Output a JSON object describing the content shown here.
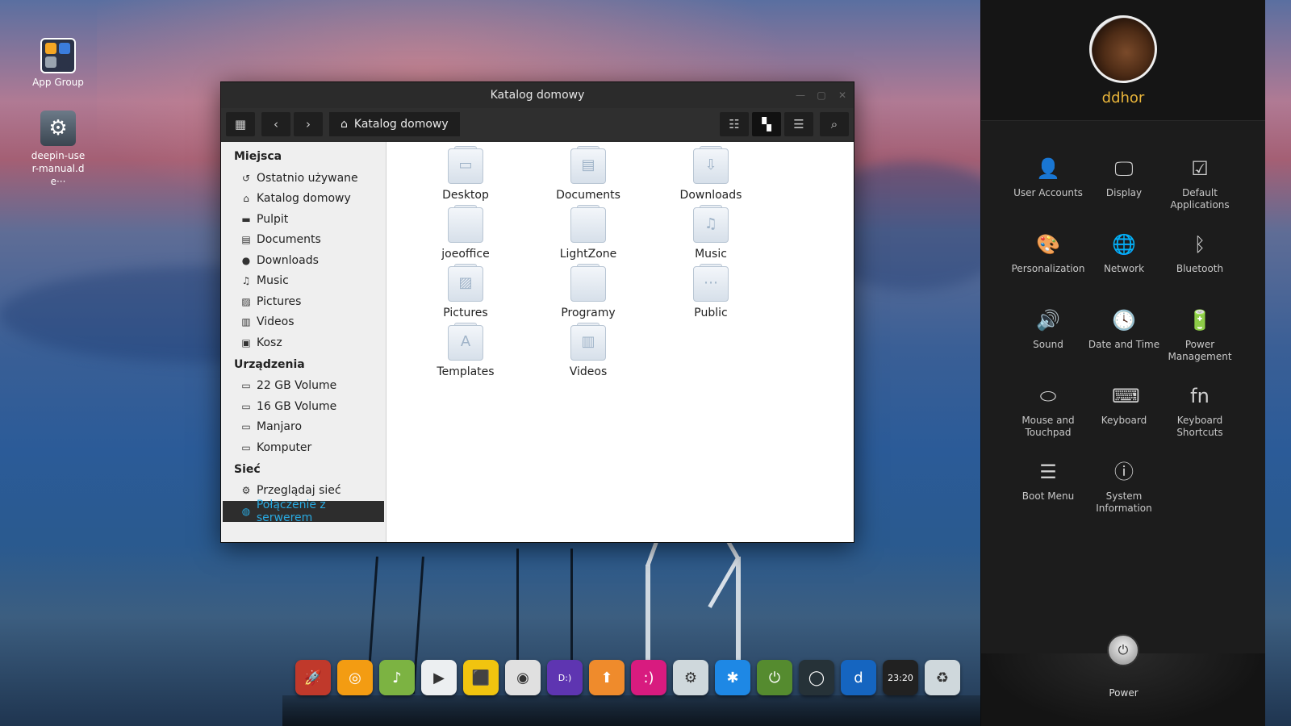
{
  "desktop": {
    "icons": [
      {
        "label": "App Group",
        "icon": "app-group-icon"
      },
      {
        "label": "deepin-user-manual.de···",
        "icon": "manual-gear-icon"
      }
    ]
  },
  "file_manager": {
    "title": "Katalog domowy",
    "toolbar": {
      "sidebar_toggle_icon": "sidebar-toggle-icon",
      "back_icon": "chevron-left-icon",
      "forward_icon": "chevron-right-icon",
      "breadcrumb": "Katalog domowy",
      "view_modes": [
        "list-view-icon",
        "icon-view-icon",
        "compact-view-icon"
      ],
      "search_icon": "search-icon"
    },
    "sidebar": {
      "sections": [
        {
          "title": "Miejsca",
          "items": [
            {
              "label": "Ostatnio używane",
              "icon": "recent-icon"
            },
            {
              "label": "Katalog domowy",
              "icon": "home-icon"
            },
            {
              "label": "Pulpit",
              "icon": "desktop-icon"
            },
            {
              "label": "Documents",
              "icon": "document-icon"
            },
            {
              "label": "Downloads",
              "icon": "download-icon"
            },
            {
              "label": "Music",
              "icon": "music-icon"
            },
            {
              "label": "Pictures",
              "icon": "picture-icon"
            },
            {
              "label": "Videos",
              "icon": "video-icon"
            },
            {
              "label": "Kosz",
              "icon": "trash-icon"
            }
          ]
        },
        {
          "title": "Urządzenia",
          "items": [
            {
              "label": "22 GB Volume",
              "icon": "drive-icon"
            },
            {
              "label": "16 GB Volume",
              "icon": "drive-icon"
            },
            {
              "label": "Manjaro",
              "icon": "drive-icon"
            },
            {
              "label": "Komputer",
              "icon": "computer-icon"
            }
          ]
        },
        {
          "title": "Sieć",
          "items": [
            {
              "label": "Przeglądaj sieć",
              "icon": "network-browse-icon"
            },
            {
              "label": "Połączenie z serwerem",
              "icon": "globe-icon",
              "selected": true
            }
          ]
        }
      ]
    },
    "files": [
      {
        "name": "Desktop",
        "glyph": "▭"
      },
      {
        "name": "Documents",
        "glyph": "▤"
      },
      {
        "name": "Downloads",
        "glyph": "⇩"
      },
      {
        "name": "joeoffice",
        "glyph": ""
      },
      {
        "name": "LightZone",
        "glyph": ""
      },
      {
        "name": "Music",
        "glyph": "♫"
      },
      {
        "name": "Pictures",
        "glyph": "▨"
      },
      {
        "name": "Programy",
        "glyph": ""
      },
      {
        "name": "Public",
        "glyph": "⋯"
      },
      {
        "name": "Templates",
        "glyph": "A"
      },
      {
        "name": "Videos",
        "glyph": "▥"
      }
    ]
  },
  "control_panel": {
    "username": "ddhor",
    "settings": [
      {
        "label": "User Accounts",
        "icon": "user-icon",
        "glyph": "👤"
      },
      {
        "label": "Display",
        "icon": "display-icon",
        "glyph": "🖵"
      },
      {
        "label": "Default Applications",
        "icon": "default-apps-icon",
        "glyph": "☑"
      },
      {
        "label": "Personalization",
        "icon": "palette-icon",
        "glyph": "🎨"
      },
      {
        "label": "Network",
        "icon": "globe-icon",
        "glyph": "🌐"
      },
      {
        "label": "Bluetooth",
        "icon": "bluetooth-icon",
        "glyph": "ᛒ"
      },
      {
        "label": "Sound",
        "icon": "speaker-icon",
        "glyph": "🔊"
      },
      {
        "label": "Date and Time",
        "icon": "clock-icon",
        "glyph": "🕓"
      },
      {
        "label": "Power Management",
        "icon": "battery-icon",
        "glyph": "🔋"
      },
      {
        "label": "Mouse and Touchpad",
        "icon": "mouse-icon",
        "glyph": "⬭"
      },
      {
        "label": "Keyboard",
        "icon": "keyboard-icon",
        "glyph": "⌨"
      },
      {
        "label": "Keyboard Shortcuts",
        "icon": "fn-key-icon",
        "glyph": "fn"
      },
      {
        "label": "Boot Menu",
        "icon": "boot-menu-icon",
        "glyph": "☰"
      },
      {
        "label": "System Information",
        "icon": "info-icon",
        "glyph": "ⓘ"
      }
    ],
    "power_label": "Power"
  },
  "dock": {
    "items": [
      {
        "icon": "launcher-rocket-icon",
        "color": "#c0392b",
        "glyph": "🚀"
      },
      {
        "icon": "browser-spiral-icon",
        "color": "#f39c12",
        "glyph": "◎"
      },
      {
        "icon": "music-player-icon",
        "color": "#7cb342",
        "glyph": "♪"
      },
      {
        "icon": "video-player-icon",
        "color": "#eceff1",
        "glyph": "▶"
      },
      {
        "icon": "package-installer-icon",
        "color": "#f1c40f",
        "glyph": "⬛"
      },
      {
        "icon": "chrome-icon",
        "color": "#e0e0e0",
        "glyph": "◉"
      },
      {
        "icon": "deepin-talk-icon",
        "color": "#5e35b1",
        "glyph": "D:)"
      },
      {
        "icon": "software-center-icon",
        "color": "#ef8b2c",
        "glyph": "⬆"
      },
      {
        "icon": "messenger-icon",
        "color": "#d81b7f",
        "glyph": ":)"
      },
      {
        "icon": "settings-icon",
        "color": "#cfd8dc",
        "glyph": "⚙"
      },
      {
        "icon": "network-config-icon",
        "color": "#1e88e5",
        "glyph": "✱"
      },
      {
        "icon": "power-leaf-icon",
        "color": "#558b2f",
        "glyph": "⏻"
      },
      {
        "icon": "webcam-icon",
        "color": "#263238",
        "glyph": "◯"
      },
      {
        "icon": "deepin-d-icon",
        "color": "#1565c0",
        "glyph": "d"
      },
      {
        "icon": "clock-widget-icon",
        "color": "#212121",
        "glyph": "23:20"
      },
      {
        "icon": "trash-icon",
        "color": "#cfd8dc",
        "glyph": "♻"
      }
    ]
  }
}
